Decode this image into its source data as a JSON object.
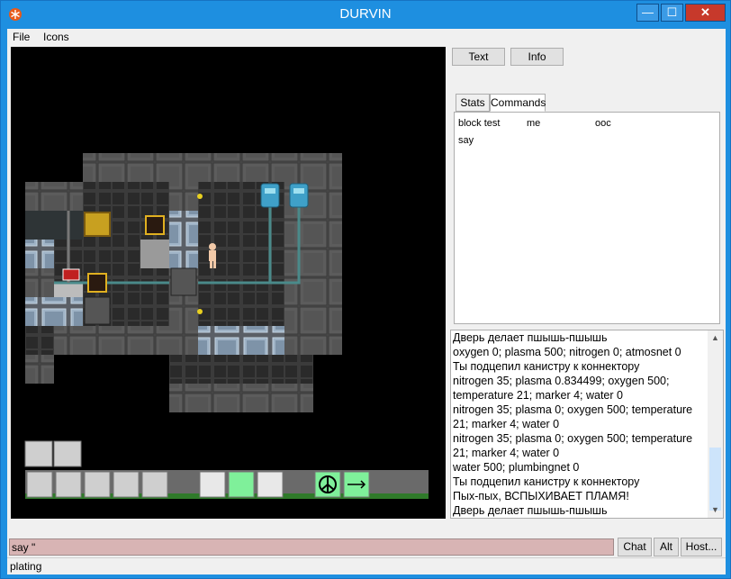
{
  "window": {
    "title": "DURVIN",
    "min_glyph": "—",
    "max_glyph": "☐",
    "close_glyph": "✕"
  },
  "menu": {
    "file": "File",
    "icons": "Icons"
  },
  "panel_buttons": {
    "text": "Text",
    "info": "Info"
  },
  "tabs": {
    "stats": "Stats",
    "commands": "Commands"
  },
  "commands": [
    "block test",
    "me",
    "ooc",
    "say"
  ],
  "output_lines": [
    "Дверь делает пшышь-пшышь",
    "oxygen 0; plasma 500; nitrogen 0; atmosnet 0",
    "Ты подцепил канистру к коннектору",
    "nitrogen 35; plasma 0.834499; oxygen 500;",
    "temperature 21; marker 4; water 0",
    "nitrogen 35; plasma 0; oxygen 500; temperature",
    "21; marker 4; water 0",
    "nitrogen 35; plasma 0; oxygen 500; temperature",
    "21; marker 4; water 0",
    "water 500; plumbingnet 0",
    "Ты подцепил канистру к коннектору",
    "Пых-пых, ВСПЫХИВАЕТ ПЛАМЯ!",
    "Дверь делает пшышь-пшышь"
  ],
  "input": {
    "value": "say \""
  },
  "bottom_buttons": {
    "chat": "Chat",
    "alt": "Alt",
    "host": "Host..."
  },
  "status": {
    "text": "plating"
  },
  "hud_icons": [
    "lie-down-icon",
    "face-icon",
    "hand-pose-icon",
    "foot-icon",
    "ear-icon",
    "chest-icon",
    "backpack-icon",
    "empty-slot",
    "intent-help-slot",
    "pull-icon",
    "peace-intent-icon",
    "move-run-icon"
  ],
  "colors": {
    "input_bg": "#d8b4b4",
    "title_bar": "#1e8fe0",
    "close_button": "#c7392b",
    "hud_green": "#7ff09a"
  }
}
